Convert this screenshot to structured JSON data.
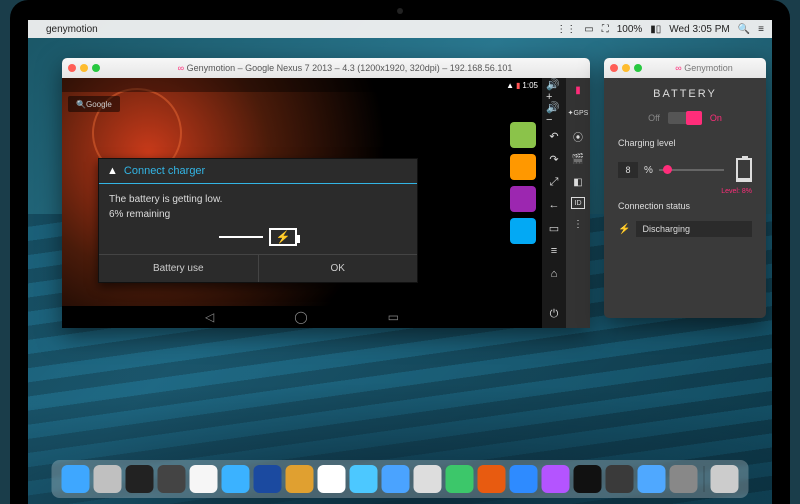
{
  "mac_menubar": {
    "app_name": "genymotion",
    "battery_pct": "100%",
    "clock": "Wed 3:05 PM"
  },
  "emulator": {
    "title": "Genymotion – Google Nexus 7 2013 – 4.3 (1200x1920, 320dpi) – 192.168.56.101",
    "status_time": "1:05",
    "google_label": "Google",
    "dialog": {
      "title": "Connect charger",
      "line1": "The battery is getting low.",
      "line2": "6% remaining",
      "btn_battery_use": "Battery use",
      "btn_ok": "OK"
    },
    "tool_gps_label": "GPS",
    "tool_id_label": "ID"
  },
  "battery_panel": {
    "window_title": "Genymotion",
    "heading": "BATTERY",
    "off_label": "Off",
    "on_label": "On",
    "charging_level_label": "Charging level",
    "level_value": "8",
    "level_unit": "%",
    "level_tooltip": "Level: 8%",
    "connection_status_label": "Connection status",
    "connection_value": "Discharging"
  },
  "dock_icons": [
    {
      "name": "finder",
      "bg": "#3ea7ff"
    },
    {
      "name": "launchpad",
      "bg": "#c0c0c0"
    },
    {
      "name": "terminal",
      "bg": "#222"
    },
    {
      "name": "activity",
      "bg": "#444"
    },
    {
      "name": "chrome",
      "bg": "#f6f6f6"
    },
    {
      "name": "safari",
      "bg": "#3bb2ff"
    },
    {
      "name": "virtualbox",
      "bg": "#1b4aa0"
    },
    {
      "name": "installer",
      "bg": "#e0a030"
    },
    {
      "name": "calendar",
      "bg": "#fff"
    },
    {
      "name": "messages",
      "bg": "#4cc8ff"
    },
    {
      "name": "mail",
      "bg": "#4aa3ff"
    },
    {
      "name": "preview",
      "bg": "#ddd"
    },
    {
      "name": "facetime",
      "bg": "#3cc76a"
    },
    {
      "name": "firefox",
      "bg": "#e85b10"
    },
    {
      "name": "dropbox",
      "bg": "#2e8bff"
    },
    {
      "name": "itunes",
      "bg": "#b454ff"
    },
    {
      "name": "genymotion",
      "bg": "#111"
    },
    {
      "name": "android-studio",
      "bg": "#3a3a3a"
    },
    {
      "name": "app-store",
      "bg": "#4fa8ff"
    },
    {
      "name": "preferences",
      "bg": "#888"
    },
    {
      "name": "trash",
      "bg": "#ccc"
    }
  ]
}
